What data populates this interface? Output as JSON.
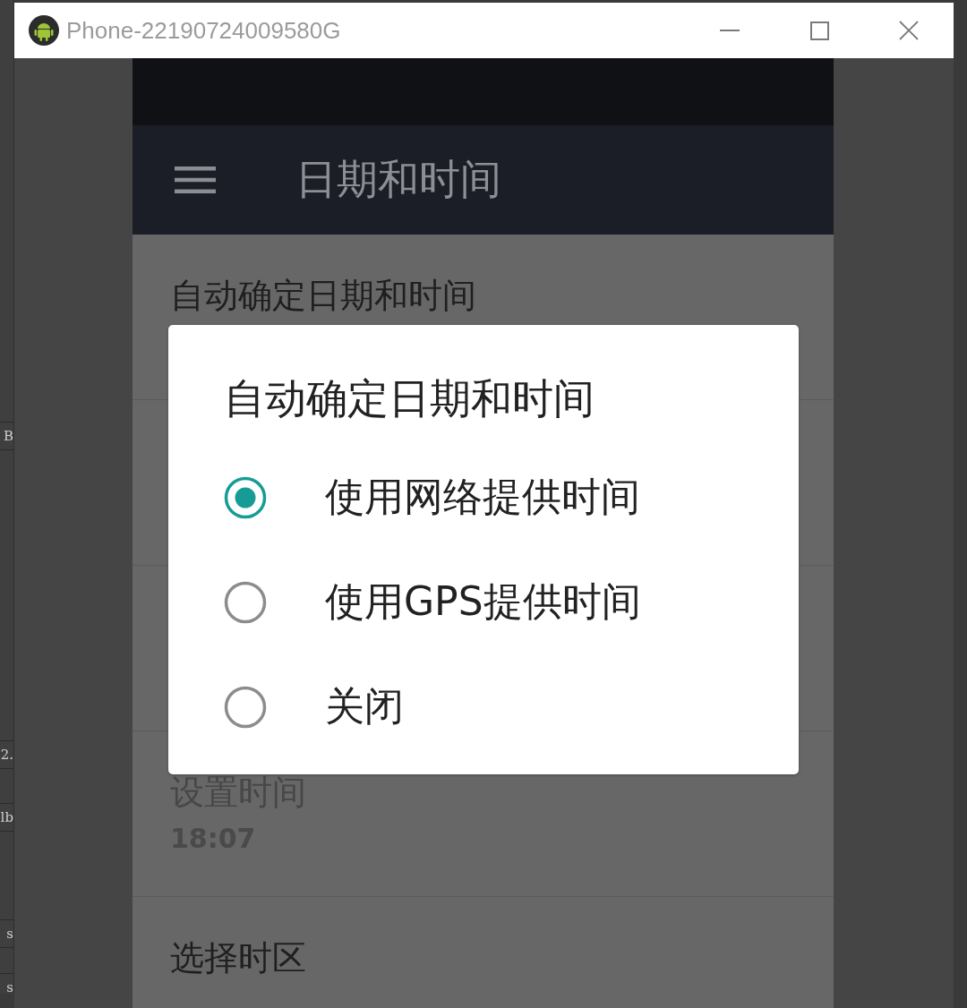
{
  "side_panel": {
    "labels": [
      "B",
      "2.",
      "lb",
      "s",
      "s"
    ]
  },
  "window": {
    "title": "Phone-22190724009580G"
  },
  "app_bar": {
    "title": "日期和时间"
  },
  "settings": [
    {
      "title": "自动确定日期和时间",
      "disabled": false
    },
    {
      "title": "设置时间",
      "summary": "18:07",
      "disabled": true
    },
    {
      "title": "选择时区",
      "disabled": false
    }
  ],
  "dialog": {
    "title": "自动确定日期和时间",
    "options": [
      {
        "label": "使用网络提供时间",
        "selected": true
      },
      {
        "label": "使用GPS提供时间",
        "selected": false
      },
      {
        "label": "关闭",
        "selected": false
      }
    ]
  }
}
